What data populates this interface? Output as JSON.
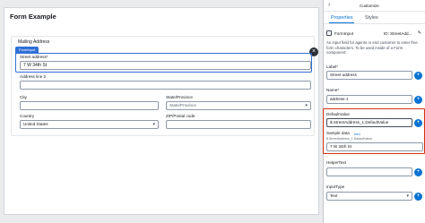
{
  "canvas": {
    "form_title": "Form Example",
    "mailing_label": "Mailing Address",
    "close_glyph": "×",
    "selected_tag": "FormInput",
    "fields": {
      "street": {
        "label": "Street address",
        "required_mark": "*",
        "value": "7 W 34th St"
      },
      "address2": {
        "label": "Address line 2",
        "value": ""
      },
      "city": {
        "label": "City",
        "value": ""
      },
      "state": {
        "label": "State/Province",
        "placeholder": "State/Province"
      },
      "country": {
        "label": "Country",
        "value": "United States"
      },
      "zip": {
        "label": "ZIP/Postal code",
        "value": ""
      }
    }
  },
  "panel": {
    "title": "Customize",
    "tabs": [
      {
        "label": "Properties",
        "active": true
      },
      {
        "label": "Styles",
        "active": false
      }
    ],
    "component_name": "FormInput",
    "component_id": "ID: StreetAdd...",
    "description": "An input field for agents or end customer to enter free form characters. To be used inside of a Form component'.",
    "label_field": {
      "label": "Label",
      "required_mark": "*",
      "value": "Street address"
    },
    "name_field": {
      "label": "Name",
      "required_mark": "*",
      "value": "address-1"
    },
    "default_value": {
      "label": "DefaultValue",
      "value": "$.StreetAddress_1.DefaultValue"
    },
    "sample_data": {
      "label": "Sample data",
      "info": "Info",
      "path": "$.StreetAddress_1.DefaultValue",
      "value": "7 W 34th St"
    },
    "helper_text": {
      "label": "HelperText",
      "value": ""
    },
    "input_type": {
      "label": "InputType",
      "value": "Text"
    }
  },
  "colors": {
    "accent": "#0972d3",
    "selection": "#2f6fd6",
    "highlight": "#d13212",
    "canvas_bg": "#e9ebed"
  },
  "icons": [
    "collapse-chevron-icon",
    "component-icon",
    "pencil-icon",
    "close-icon",
    "chevron-down-icon",
    "plus-icon"
  ]
}
